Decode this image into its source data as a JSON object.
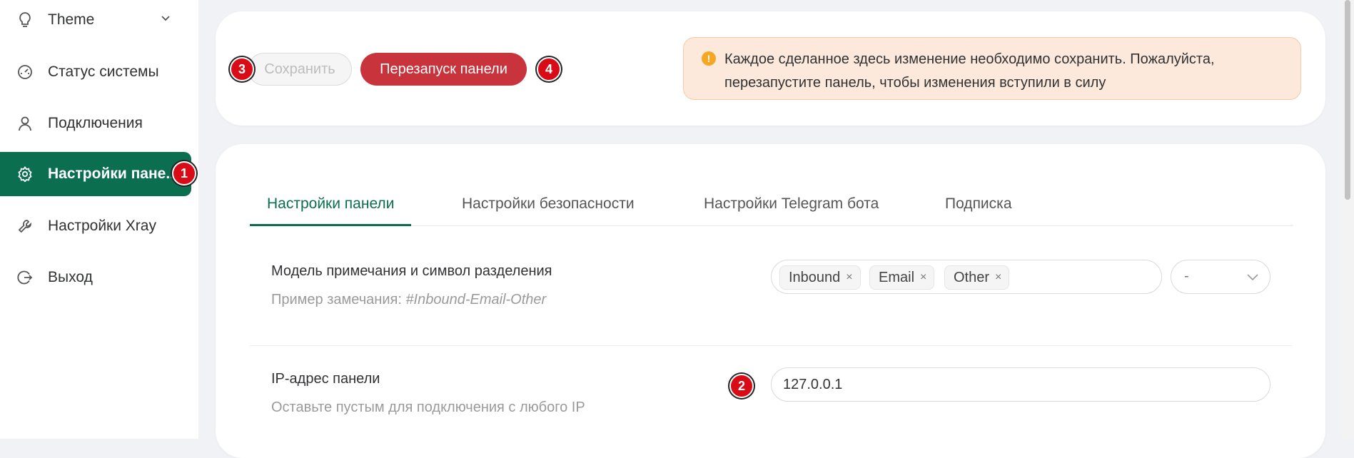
{
  "sidebar": {
    "items": [
      {
        "label": "Theme",
        "icon": "lightbulb-icon"
      },
      {
        "label": "Статус системы",
        "icon": "dashboard-icon"
      },
      {
        "label": "Подключения",
        "icon": "user-icon"
      },
      {
        "label": "Настройки пане...",
        "icon": "gear-icon",
        "active": true
      },
      {
        "label": "Настройки Xray",
        "icon": "wrench-icon"
      },
      {
        "label": "Выход",
        "icon": "logout-icon"
      }
    ]
  },
  "badges": [
    "1",
    "2",
    "3",
    "4"
  ],
  "toolbar": {
    "save_label": "Сохранить",
    "restart_label": "Перезапуск панели"
  },
  "alert": {
    "icon_symbol": "!",
    "text": "Каждое сделанное здесь изменение необходимо сохранить. Пожалуйста, перезапустите панель, чтобы изменения вступили в силу"
  },
  "tabs": [
    {
      "label": "Настройки панели",
      "active": true
    },
    {
      "label": "Настройки безопасности"
    },
    {
      "label": "Настройки Telegram бота"
    },
    {
      "label": "Подписка"
    }
  ],
  "settings": {
    "remark": {
      "title": "Модель примечания и символ разделения",
      "desc_prefix": "Пример замечания: ",
      "desc_example": "#Inbound-Email-Other",
      "tags": [
        "Inbound",
        "Email",
        "Other"
      ],
      "tag_remove_symbol": "×",
      "separator": "-"
    },
    "ip": {
      "title": "IP-адрес панели",
      "desc": "Оставьте пустым для подключения с любого IP",
      "value": "127.0.0.1"
    }
  },
  "colors": {
    "accent": "#0b6e4f",
    "danger": "#c9333b",
    "badge": "#d90b16",
    "alert_bg": "#fde9dc"
  }
}
